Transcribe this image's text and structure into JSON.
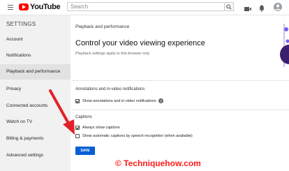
{
  "header": {
    "logo_text": "YouTube",
    "search_placeholder": "Search"
  },
  "sidebar": {
    "title": "SETTINGS",
    "items": [
      {
        "label": "Account"
      },
      {
        "label": "Notifications"
      },
      {
        "label": "Playback and performance"
      },
      {
        "label": "Privacy"
      },
      {
        "label": "Connected accounts"
      },
      {
        "label": "Watch on TV"
      },
      {
        "label": "Billing & payments"
      },
      {
        "label": "Advanced settings"
      }
    ]
  },
  "main": {
    "section_label": "Playback and performance",
    "heading": "Control your video viewing experience",
    "subheading": "Playback settings apply to this browser only",
    "annotations": {
      "title": "Annotations and in-video notifications",
      "option": "Show annotations and in-video notifications"
    },
    "captions": {
      "title": "Captions",
      "always_show": "Always show captions",
      "auto_captions": "Show automatic captions by speech recognition (when available)"
    },
    "save_label": "SAVE"
  },
  "watermark": "© Techniquehow.com",
  "colors": {
    "brand_red": "#ff0000",
    "save_blue": "#065fd4",
    "arrow_red": "#e3202a",
    "sidebar_bg": "#f1f1f1"
  }
}
